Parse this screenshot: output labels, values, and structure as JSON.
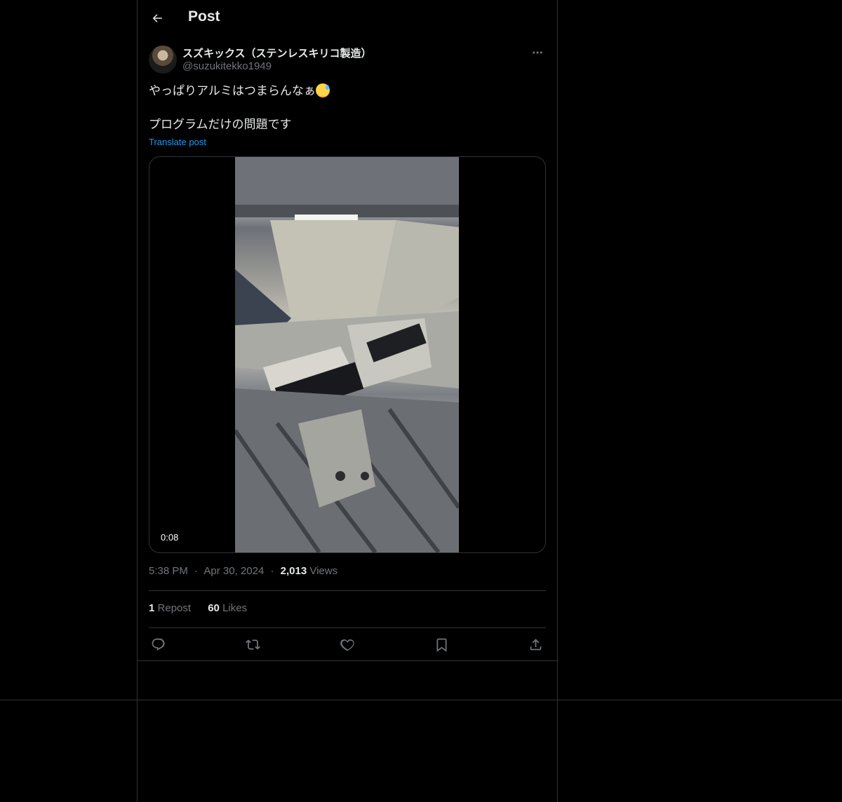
{
  "header": {
    "title": "Post",
    "back_icon": "arrow-left-icon"
  },
  "author": {
    "display_name": "スズキックス（ステンレスキリコ製造）",
    "handle": "@suzukitekko1949",
    "more_icon": "more-horizontal-icon"
  },
  "post": {
    "line1": "やっぱりアルミはつまらんなぁ",
    "line1_emoji": "sweat-smile-emoji",
    "line2": "プログラムだけの問題です",
    "translate_label": "Translate post"
  },
  "media": {
    "duration": "0:08"
  },
  "meta": {
    "time": "5:38 PM",
    "date": "Apr 30, 2024",
    "views_count": "2,013",
    "views_label": "Views",
    "separator": "·"
  },
  "stats": {
    "reposts_count": "1",
    "reposts_label": "Repost",
    "likes_count": "60",
    "likes_label": "Likes"
  },
  "actions": [
    "reply-icon",
    "repost-icon",
    "like-icon",
    "bookmark-icon",
    "share-icon"
  ],
  "colors": {
    "background": "#000000",
    "text": "#e7e9ea",
    "secondary": "#71767b",
    "border": "#2f3336",
    "link": "#1d9bf0"
  }
}
